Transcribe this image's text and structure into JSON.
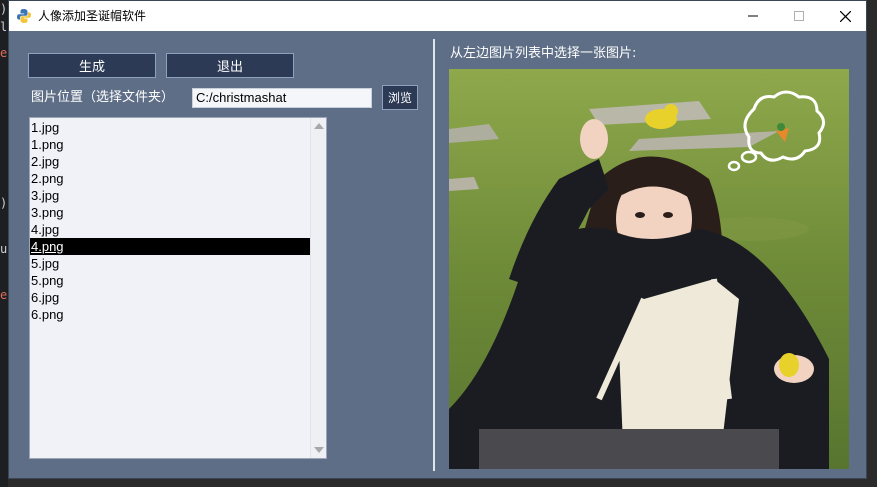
{
  "window": {
    "title": "人像添加圣诞帽软件",
    "controls": [
      "minimize-icon",
      "maximize-icon",
      "close-icon"
    ]
  },
  "left_panel": {
    "generate_label": "生成",
    "exit_label": "退出",
    "location_label": "图片位置（选择文件夹）",
    "path_value": "C:/christmashat",
    "browse_label": "浏览",
    "files": [
      "1.jpg",
      "1.png",
      "2.jpg",
      "2.png",
      "3.jpg",
      "3.png",
      "4.jpg",
      "4.png",
      "5.jpg",
      "5.png",
      "6.jpg",
      "6.png"
    ],
    "selected_index": 7
  },
  "right_panel": {
    "prompt": "从左边图片列表中选择一张图片:",
    "photo_description": "photo-preview"
  },
  "colors": {
    "window_bg": "#5e6e86",
    "button_bg": "#2c3a55",
    "selected_bg": "#000000",
    "list_bg": "#f0f2f8"
  }
}
